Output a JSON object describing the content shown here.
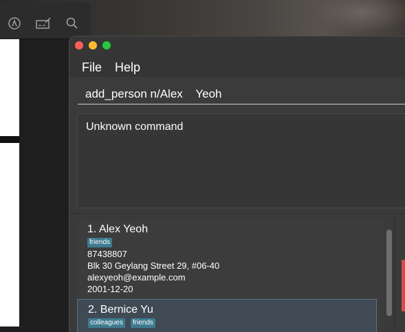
{
  "window": {
    "menu": [
      "File",
      "Help"
    ]
  },
  "command_box": {
    "value": "add_person n/Alex    Yeoh"
  },
  "result_display": {
    "text": "Unknown command"
  },
  "persons": [
    {
      "index": "1.",
      "name": "Alex Yeoh",
      "tags": [
        "friends"
      ],
      "phone": "87438807",
      "address": "Blk 30 Geylang Street 29, #06-40",
      "email": "alexyeoh@example.com",
      "date": "2001-12-20"
    },
    {
      "index": "2.",
      "name": "Bernice Yu",
      "tags": [
        "colleagues",
        "friends"
      ]
    }
  ],
  "background_toolbar_icons": [
    "markup-icon",
    "signature-icon",
    "search-icon"
  ],
  "colors": {
    "tag": "#3e7b91",
    "selected_card": "#3f4a55",
    "close": "#fe5f57",
    "minimize": "#febc2e",
    "zoom": "#28c840"
  }
}
